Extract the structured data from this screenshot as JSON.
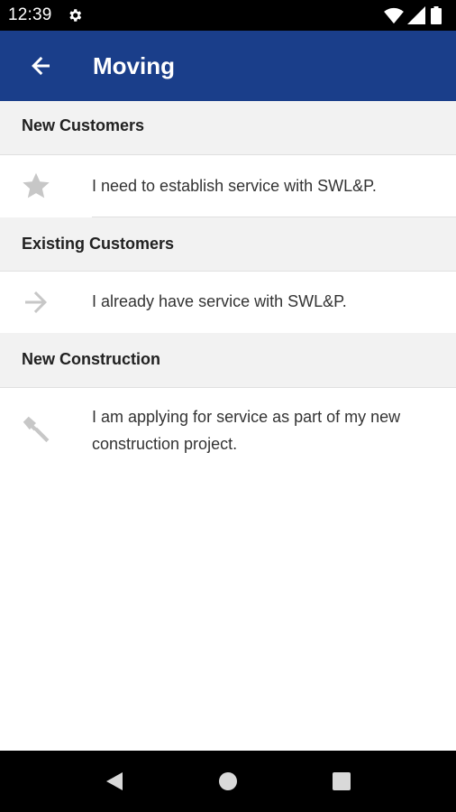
{
  "status": {
    "time": "12:39"
  },
  "app_bar": {
    "title": "Moving"
  },
  "sections": [
    {
      "header": "New Customers",
      "text": "I need to establish service with SWL&P.",
      "icon": "star-icon"
    },
    {
      "header": "Existing Customers",
      "text": "I already have service with SWL&P.",
      "icon": "arrow-right-icon"
    },
    {
      "header": "New Construction",
      "text": "I am applying for service as part of my new construction project.",
      "icon": "hammer-icon"
    }
  ],
  "colors": {
    "app_bar": "#1a3e8a",
    "section_header_bg": "#f2f2f2",
    "icon_gray": "#c7c7c7"
  }
}
